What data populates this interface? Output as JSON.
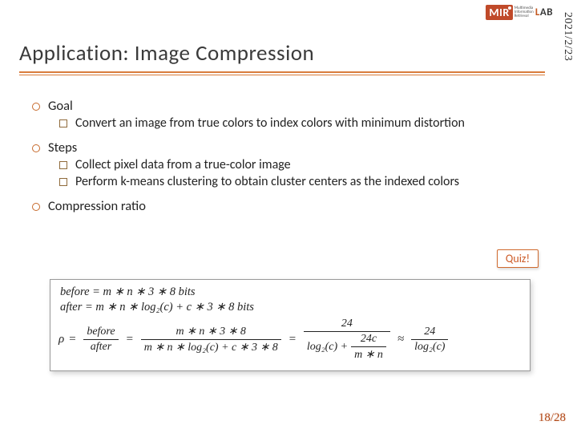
{
  "header": {
    "date": "2021/2/23",
    "logo": {
      "mir": "MIR",
      "sub": "Multimedia\nInformation\nRetrieval",
      "lab_l": "L",
      "lab_a": "A",
      "lab_b": "B"
    }
  },
  "title": "Application: Image Compression",
  "body": {
    "goal": {
      "label": "Goal",
      "items": [
        "Convert an image from true colors to index colors with minimum distortion"
      ]
    },
    "steps": {
      "label": "Steps",
      "items": [
        "Collect pixel data from a true-color image",
        "Perform k-means clustering to obtain cluster centers as the indexed colors"
      ]
    },
    "compression": {
      "label": "Compression ratio"
    }
  },
  "quiz_label": "Quiz!",
  "formula": {
    "before_line": "before = m ∗ n ∗ 3 ∗ 8 bits",
    "after_line": "after = m ∗ n ∗ log₂(c) + c ∗ 3 ∗ 8 bits",
    "rho_symbol": "ρ",
    "frac1_num": "before",
    "frac1_den": "after",
    "frac2_num": "m ∗ n ∗ 3 ∗ 8",
    "frac2_den": "m ∗ n ∗ log₂(c) + c ∗ 3 ∗ 8",
    "frac3_num": "24",
    "frac3_den_combined": "log₂(c) + 24c / (m ∗ n)",
    "frac3_den_a": "log₂(c) +",
    "frac3_den_b_num": "24c",
    "frac3_den_b_den": "m ∗ n",
    "approx": "≈",
    "frac4_num": "24",
    "frac4_den": "log₂(c)"
  },
  "page_number": "18/28"
}
